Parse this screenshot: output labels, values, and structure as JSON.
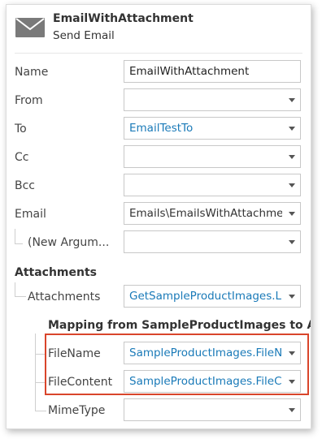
{
  "header": {
    "title": "EmailWithAttachment",
    "subtitle": "Send Email",
    "icon": "envelope-icon"
  },
  "properties": {
    "name": {
      "label": "Name",
      "value": "EmailWithAttachment"
    },
    "from": {
      "label": "From",
      "value": ""
    },
    "to": {
      "label": "To",
      "value": "EmailTestTo"
    },
    "cc": {
      "label": "Cc",
      "value": ""
    },
    "bcc": {
      "label": "Bcc",
      "value": ""
    },
    "email": {
      "label": "Email",
      "value": "Emails\\EmailsWithAttachments"
    },
    "new_argument": {
      "label": "(New Argum...",
      "value": ""
    }
  },
  "attachments": {
    "section_label": "Attachments",
    "field": {
      "label": "Attachments",
      "value": "GetSampleProductImages.List"
    },
    "mapping_title": "Mapping from SampleProductImages to Attachment",
    "mappings": [
      {
        "label": "FileName",
        "value": "SampleProductImages.FileName"
      },
      {
        "label": "FileContent",
        "value": "SampleProductImages.FileContent"
      },
      {
        "label": "MimeType",
        "value": ""
      }
    ]
  },
  "colors": {
    "link_value": "#1a7ab8",
    "highlight_border": "#d9452b"
  }
}
